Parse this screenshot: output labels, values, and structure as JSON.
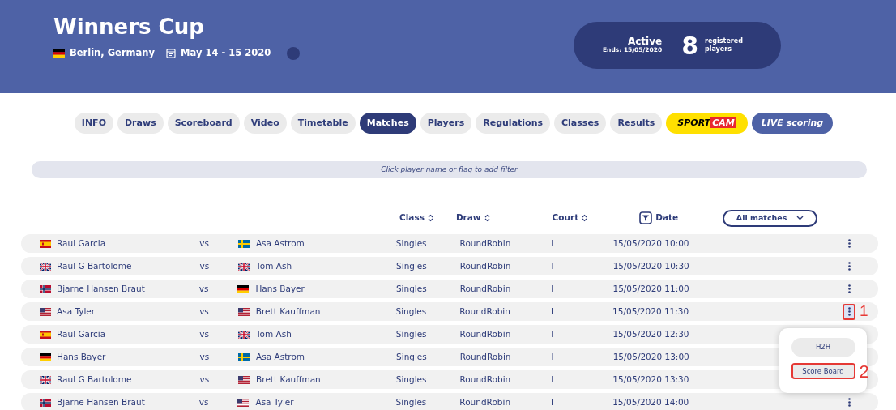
{
  "header": {
    "title": "Winners Cup",
    "location": {
      "kind": "germany",
      "text": "Berlin, Germany"
    },
    "dates": "May 14 - 15 2020",
    "status": "Active",
    "ends": "Ends: 15/05/2020",
    "players_count": "8",
    "players_label": "registered players"
  },
  "tabs": [
    {
      "kind": "plain",
      "label": "INFO",
      "selected": false
    },
    {
      "kind": "plain",
      "label": "Draws",
      "selected": false
    },
    {
      "kind": "plain",
      "label": "Scoreboard",
      "selected": false
    },
    {
      "kind": "plain",
      "label": "Video",
      "selected": false
    },
    {
      "kind": "plain",
      "label": "Timetable",
      "selected": false
    },
    {
      "kind": "plain",
      "label": "Matches",
      "selected": true
    },
    {
      "kind": "plain",
      "label": "Players",
      "selected": false
    },
    {
      "kind": "plain",
      "label": "Regulations",
      "selected": false
    },
    {
      "kind": "plain",
      "label": "Classes",
      "selected": false
    },
    {
      "kind": "plain",
      "label": "Results",
      "selected": false
    },
    {
      "kind": "sportcam",
      "parts": [
        "SPORT",
        "CAM"
      ],
      "selected": false
    },
    {
      "kind": "live",
      "label": "**LIVE** scoring",
      "selected": false
    }
  ],
  "filter_hint": "Click player name or flag to add filter",
  "columns": [
    {
      "label": "Class",
      "kind": "sort"
    },
    {
      "label": "Draw",
      "kind": "sort"
    },
    {
      "label": "Court",
      "kind": "sort"
    },
    {
      "label": "Date",
      "kind": "filter"
    }
  ],
  "match_filter": "All matches",
  "rows": [
    {
      "player_1": {
        "kind": "spain",
        "name": "Raul Garcia"
      },
      "vs": "vs",
      "player_2": {
        "kind": "sweden",
        "name": "Asa Astrom"
      },
      "class": "Singles",
      "draw": "RoundRobin",
      "court": "I",
      "date": "15/05/2020 10:00",
      "menu_open": false
    },
    {
      "player_1": {
        "kind": "uk",
        "name": "Raul G Bartolome"
      },
      "vs": "vs",
      "player_2": {
        "kind": "uk",
        "name": "Tom Ash"
      },
      "class": "Singles",
      "draw": "RoundRobin",
      "court": "I",
      "date": "15/05/2020 10:30",
      "menu_open": false
    },
    {
      "player_1": {
        "kind": "norway",
        "name": "Bjarne Hansen Braut"
      },
      "vs": "vs",
      "player_2": {
        "kind": "germany",
        "name": "Hans Bayer"
      },
      "class": "Singles",
      "draw": "RoundRobin",
      "court": "I",
      "date": "15/05/2020 11:00",
      "menu_open": false
    },
    {
      "player_1": {
        "kind": "usa",
        "name": "Asa Tyler"
      },
      "vs": "vs",
      "player_2": {
        "kind": "usa",
        "name": "Brett Kauffman"
      },
      "class": "Singles",
      "draw": "RoundRobin",
      "court": "I",
      "date": "15/05/2020 11:30",
      "menu_open": true,
      "callout": "1"
    },
    {
      "player_1": {
        "kind": "spain",
        "name": "Raul Garcia"
      },
      "vs": "vs",
      "player_2": {
        "kind": "uk",
        "name": "Tom Ash"
      },
      "class": "Singles",
      "draw": "RoundRobin",
      "court": "I",
      "date": "15/05/2020 12:30"
    },
    {
      "player_1": {
        "kind": "germany",
        "name": "Hans Bayer"
      },
      "vs": "vs",
      "player_2": {
        "kind": "sweden",
        "name": "Asa Astrom"
      },
      "class": "Singles",
      "draw": "RoundRobin",
      "court": "I",
      "date": "15/05/2020 13:00"
    },
    {
      "player_1": {
        "kind": "uk",
        "name": "Raul G Bartolome"
      },
      "vs": "vs",
      "player_2": {
        "kind": "usa",
        "name": "Brett Kauffman"
      },
      "class": "Singles",
      "draw": "RoundRobin",
      "court": "I",
      "date": "15/05/2020 13:30"
    },
    {
      "player_1": {
        "kind": "norway",
        "name": "Bjarne Hansen Braut"
      },
      "vs": "vs",
      "player_2": {
        "kind": "usa",
        "name": "Asa Tyler"
      },
      "class": "Singles",
      "draw": "RoundRobin",
      "court": "I",
      "date": "15/05/2020 14:00",
      "menu_open": false
    }
  ],
  "row_menu": [
    {
      "label": "H2H",
      "highlighted": false
    },
    {
      "label": "Score Board",
      "highlighted": true,
      "callout": "2"
    }
  ]
}
